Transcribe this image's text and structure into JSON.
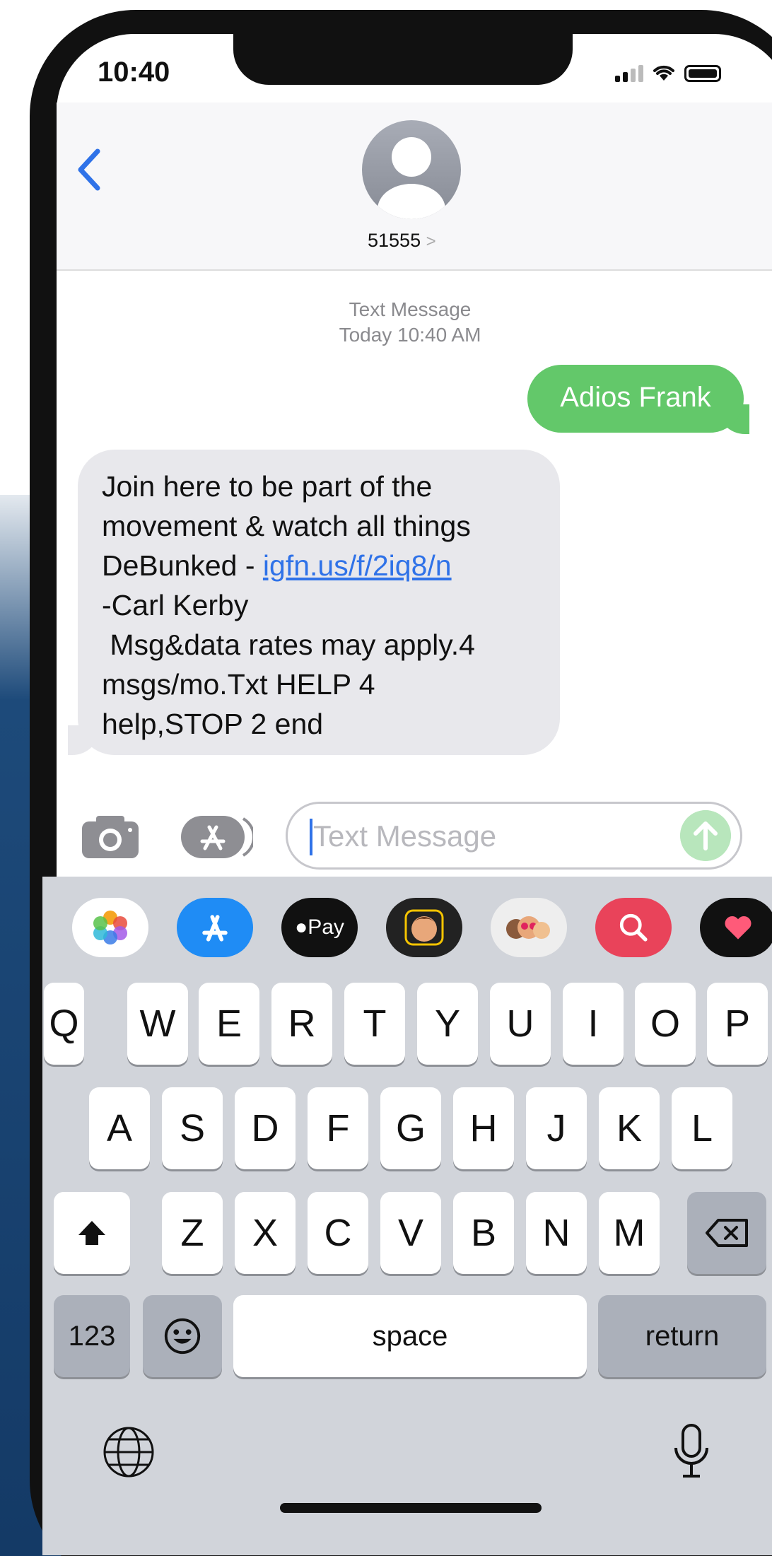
{
  "status": {
    "time": "10:40"
  },
  "header": {
    "contact": "51555",
    "chevron": ">"
  },
  "timestamp": {
    "line1": "Text Message",
    "line2": "Today 10:40 AM"
  },
  "messages": {
    "outgoing": "Adios Frank",
    "incoming": {
      "line1": "Join here to be part of the",
      "line2": "movement & watch all things",
      "line3_prefix": "DeBunked - ",
      "link": "igfn.us/f/2iq8/n",
      "line4": "-Carl Kerby",
      "line5": " Msg&data rates may apply.4",
      "line6": "msgs/mo.Txt HELP 4",
      "line7": "help,STOP 2 end"
    }
  },
  "compose": {
    "placeholder": "Text Message"
  },
  "apps": [
    "photos-icon",
    "app-store-icon",
    "apple-pay-icon",
    "memoji-icon",
    "memoji-stickers-icon",
    "web-search-icon",
    "digital-touch-icon"
  ],
  "apple_pay_label": "Pay",
  "keyboard": {
    "row1": [
      "Q",
      "W",
      "E",
      "R",
      "T",
      "Y",
      "U",
      "I",
      "O",
      "P"
    ],
    "row2": [
      "A",
      "S",
      "D",
      "F",
      "G",
      "H",
      "J",
      "K",
      "L"
    ],
    "row3": [
      "Z",
      "X",
      "C",
      "V",
      "B",
      "N",
      "M"
    ],
    "numbers": "123",
    "space": "space",
    "return": "return"
  },
  "colors": {
    "accent": "#2f72e8",
    "outgoing_bubble": "#63c86a",
    "incoming_bubble": "#e8e8ec"
  }
}
